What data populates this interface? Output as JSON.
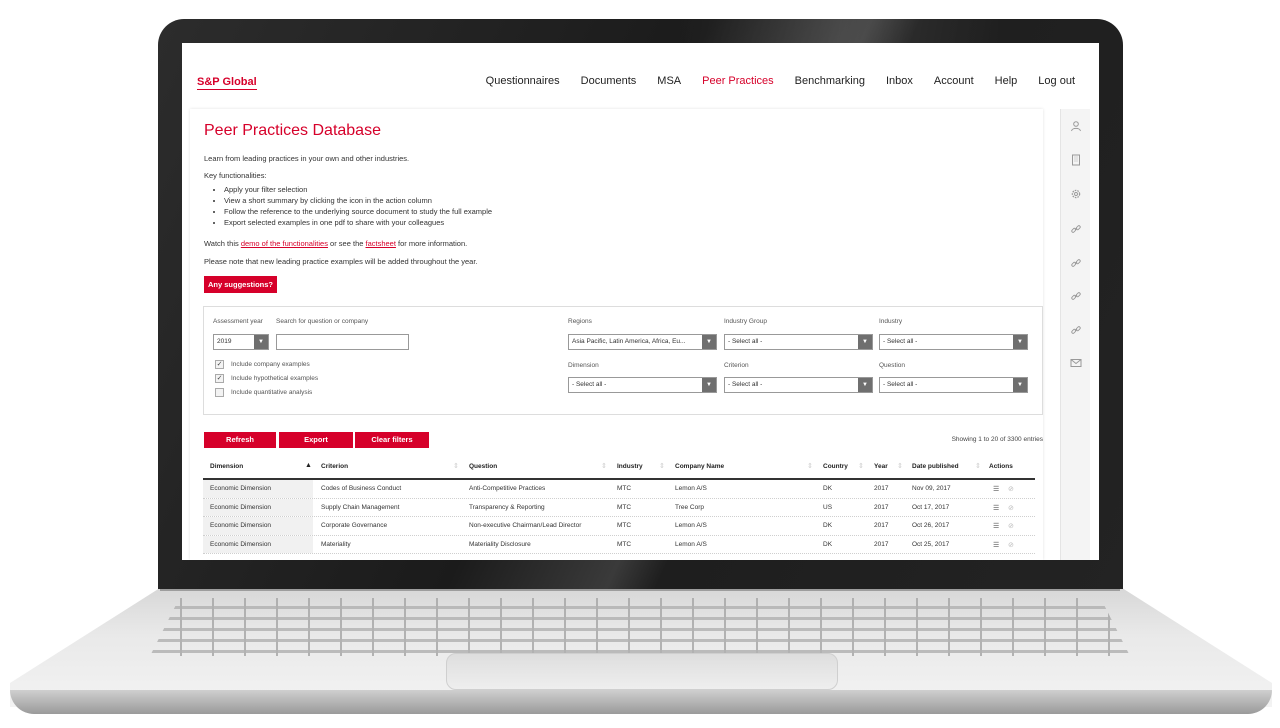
{
  "header": {
    "logo": "S&P Global",
    "nav": [
      "Questionnaires",
      "Documents",
      "MSA",
      "Peer Practices",
      "Benchmarking",
      "Inbox",
      "Account",
      "Help",
      "Log out"
    ],
    "active_nav": "Peer Practices",
    "accent_color": "#d6002a"
  },
  "page": {
    "title": "Peer Practices Database",
    "intro": "Learn from leading practices in your own and other industries.",
    "key_label": "Key functionalities:",
    "bullets": [
      "Apply your filter selection",
      "View a short summary by clicking the icon in the action column",
      "Follow the reference to the underlying source document to study the full example",
      "Export selected examples in one pdf to share with your colleagues"
    ],
    "watch_prefix": "Watch this ",
    "watch_link": "demo of the functionalities",
    "watch_mid": " or see the ",
    "factsheet_link": "factsheet",
    "watch_suffix": " for more information.",
    "note": "Please note that new leading practice examples will be added throughout the year.",
    "suggest_button": "Any suggestions?"
  },
  "filters": {
    "assessment_year_label": "Assessment year",
    "assessment_year_value": "2019",
    "search_label": "Search for question or company",
    "search_value": "",
    "regions_label": "Regions",
    "regions_value": "Asia Pacific, Latin America, Africa, Eu...",
    "industry_group_label": "Industry Group",
    "industry_group_value": "- Select all -",
    "industry_label": "Industry",
    "industry_value": "- Select all -",
    "dimension_label": "Dimension",
    "dimension_value": "- Select all -",
    "criterion_label": "Criterion",
    "criterion_value": "- Select all -",
    "question_label": "Question",
    "question_value": "- Select all -",
    "checkboxes": [
      {
        "label": "Include company examples",
        "checked": true
      },
      {
        "label": "Include hypothetical examples",
        "checked": true
      },
      {
        "label": "Include quantitative analysis",
        "checked": false
      }
    ]
  },
  "actions": {
    "refresh": "Refresh",
    "export": "Export",
    "clear": "Clear filters",
    "showing": "Showing 1 to 20 of 3300 entries"
  },
  "table": {
    "columns": [
      "Dimension",
      "Criterion",
      "Question",
      "Industry",
      "Company Name",
      "Country",
      "Year",
      "Date published",
      "Actions"
    ],
    "rows": [
      [
        "Economic Dimension",
        "Codes of Business Conduct",
        "Anti-Competitive Practices",
        "MTC",
        "Lemon A/S",
        "DK",
        "2017",
        "Nov 09, 2017"
      ],
      [
        "Economic Dimension",
        "Supply Chain Management",
        "Transparency & Reporting",
        "MTC",
        "Tree Corp",
        "US",
        "2017",
        "Oct 17, 2017"
      ],
      [
        "Economic Dimension",
        "Corporate Governance",
        "Non-executive Chairman/Lead Director",
        "MTC",
        "Lemon A/S",
        "DK",
        "2017",
        "Oct 26, 2017"
      ],
      [
        "Economic Dimension",
        "Materiality",
        "Materiality Disclosure",
        "MTC",
        "Lemon A/S",
        "DK",
        "2017",
        "Oct 25, 2017"
      ]
    ]
  },
  "rail_icons": [
    "user-icon",
    "building-icon",
    "gear-icon",
    "link-icon",
    "link-icon",
    "link-icon",
    "link-icon",
    "mail-icon"
  ]
}
